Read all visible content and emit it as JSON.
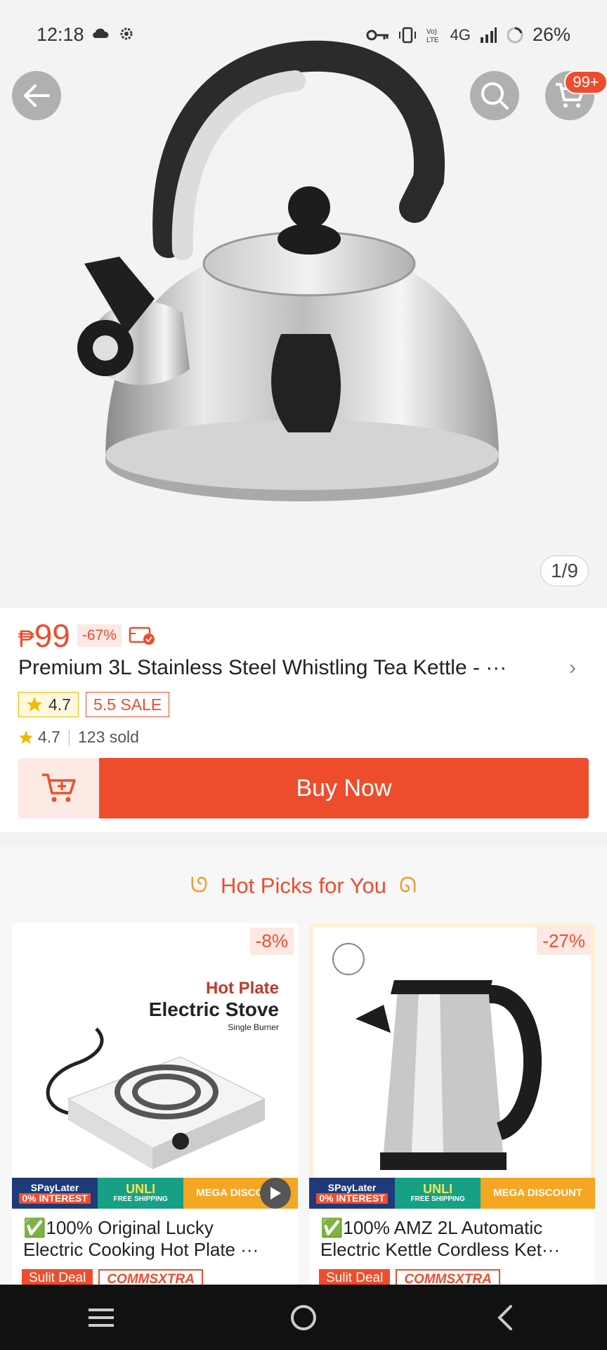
{
  "status_bar": {
    "time": "12:18",
    "network": "4G",
    "battery": "26%"
  },
  "header": {
    "cart_badge": "99+",
    "image_counter": "1/9"
  },
  "product": {
    "currency": "₱",
    "price": "99",
    "discount": "-67%",
    "title": "Premium 3L Stainless Steel Whistling Tea Kettle - ···",
    "rating_badge": "4.7",
    "sale_badge": "5.5 SALE",
    "rating": "4.7",
    "sold": "123 sold",
    "buy_label": "Buy Now"
  },
  "hot_picks": {
    "title": "Hot Picks for You",
    "items": [
      {
        "discount": "-8%",
        "name_line1": "✅100% Original Lucky",
        "name_line2": "Electric Cooking Hot Plate ···",
        "image_text_1": "Hot Plate",
        "image_text_2": "Electric Stove",
        "image_text_3": "Single Burner",
        "tag_deal": "Sulit Deal",
        "tag_comms": "COMMSXTRA"
      },
      {
        "discount": "-27%",
        "name_line1": "✅100% AMZ 2L Automatic",
        "name_line2": "Electric Kettle Cordless Ket···",
        "tag_deal": "Sulit Deal",
        "tag_comms": "COMMSXTRA"
      }
    ],
    "promo": {
      "spaylater": "SPayLater",
      "interest": "0% INTEREST",
      "unli": "UNLI",
      "free_shipping": "FREE SHIPPING",
      "mega": "MEGA DISCOUNT"
    }
  },
  "colors": {
    "accent": "#ee4d2d",
    "star": "#f5b700"
  }
}
